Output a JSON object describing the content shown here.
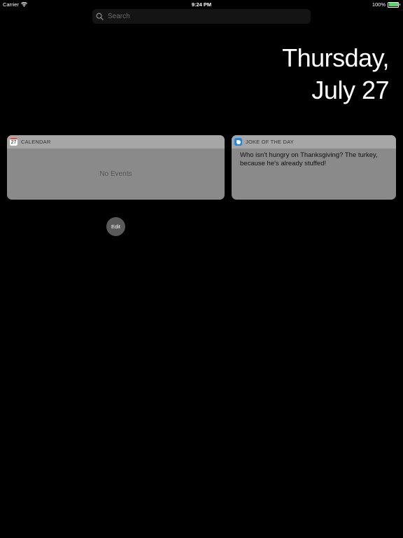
{
  "status_bar": {
    "carrier": "Carrier",
    "time": "9:24 PM",
    "battery_percent": "100%",
    "battery_level": 1.0,
    "battery_color": "#4cd964"
  },
  "search": {
    "placeholder": "Search"
  },
  "date": {
    "weekday": "Thursday,",
    "month_day": "July 27"
  },
  "widgets": {
    "calendar": {
      "icon": "calendar-icon",
      "icon_number": "27",
      "title": "CALENDAR",
      "body": "No Events"
    },
    "joke": {
      "icon": "joke-app-icon",
      "title": "JOKE OF THE DAY",
      "body": "Who isn't hungry on Thanksgiving? The turkey, because he's already stuffed!"
    }
  },
  "edit": {
    "label": "Edit"
  }
}
